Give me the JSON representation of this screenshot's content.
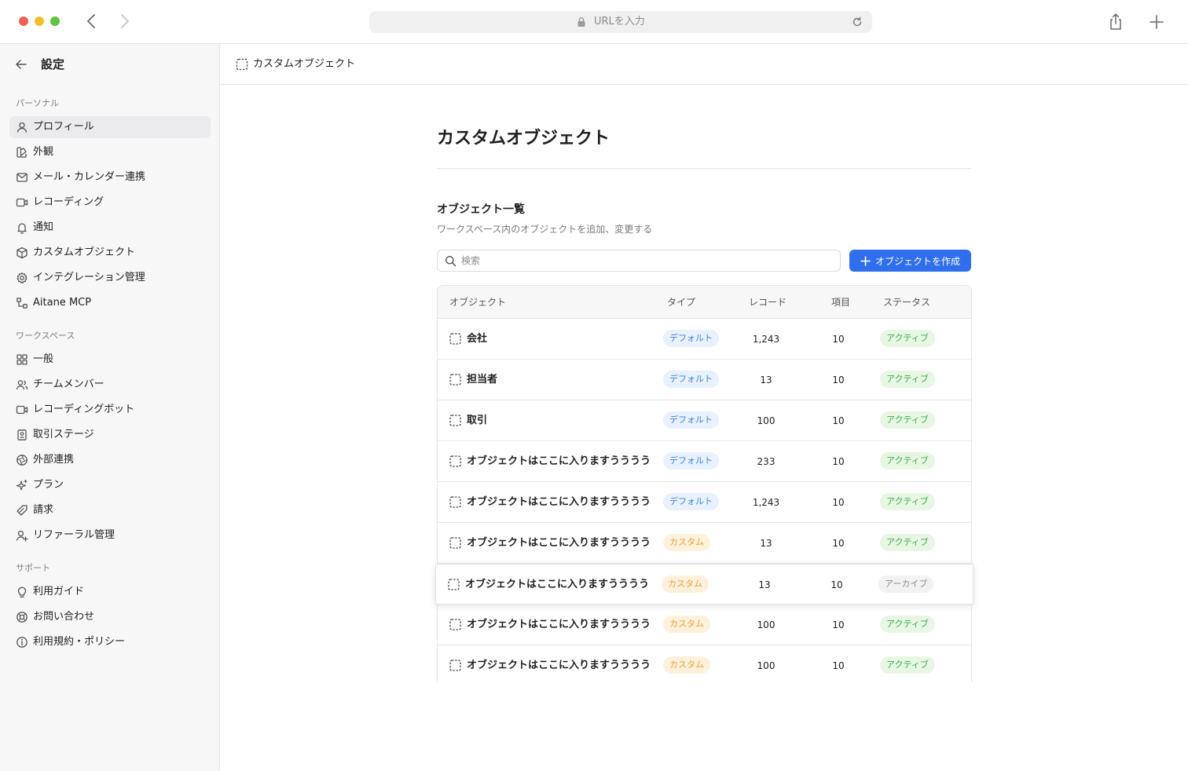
{
  "browser": {
    "url_placeholder": "URLを入力"
  },
  "sidebar": {
    "title": "設定",
    "sections": [
      {
        "label": "パーソナル",
        "items": [
          {
            "label": "プロフィール",
            "icon": "user-icon",
            "active": true
          },
          {
            "label": "外観",
            "icon": "palette-icon"
          },
          {
            "label": "メール・カレンダー連携",
            "icon": "mail-icon"
          },
          {
            "label": "レコーディング",
            "icon": "video-icon"
          },
          {
            "label": "通知",
            "icon": "bell-icon"
          },
          {
            "label": "カスタムオブジェクト",
            "icon": "cube-icon"
          },
          {
            "label": "インテグレーション管理",
            "icon": "gear-icon"
          },
          {
            "label": "Aitane MCP",
            "icon": "connection-icon"
          }
        ]
      },
      {
        "label": "ワークスペース",
        "items": [
          {
            "label": "一般",
            "icon": "grid-icon"
          },
          {
            "label": "チームメンバー",
            "icon": "users-icon"
          },
          {
            "label": "レコーディングボット",
            "icon": "video-icon"
          },
          {
            "label": "取引ステージ",
            "icon": "receipt-icon"
          },
          {
            "label": "外部連携",
            "icon": "aperture-icon"
          },
          {
            "label": "プラン",
            "icon": "sparkle-icon"
          },
          {
            "label": "請求",
            "icon": "tag-icon"
          },
          {
            "label": "リファーラル管理",
            "icon": "user-plus-icon"
          }
        ]
      },
      {
        "label": "サポート",
        "items": [
          {
            "label": "利用ガイド",
            "icon": "lightbulb-icon"
          },
          {
            "label": "お問い合わせ",
            "icon": "lifebuoy-icon"
          },
          {
            "label": "利用規約・ポリシー",
            "icon": "info-icon"
          }
        ]
      }
    ]
  },
  "topbar": {
    "title": "カスタムオブジェクト"
  },
  "main": {
    "page_title": "カスタムオブジェクト",
    "section_title": "オブジェクト一覧",
    "section_desc": "ワークスペース内のオブジェクトを追加、変更する",
    "search_placeholder": "検索",
    "create_button": "オブジェクトを作成"
  },
  "table": {
    "headers": [
      "オブジェクト",
      "タイプ",
      "レコード",
      "項目",
      "ステータス"
    ],
    "rows": [
      {
        "name": "会社",
        "type": "デフォルト",
        "type_kind": "default",
        "records": "1,243",
        "fields": "10",
        "status": "アクティブ",
        "status_kind": "active"
      },
      {
        "name": "担当者",
        "type": "デフォルト",
        "type_kind": "default",
        "records": "13",
        "fields": "10",
        "status": "アクティブ",
        "status_kind": "active"
      },
      {
        "name": "取引",
        "type": "デフォルト",
        "type_kind": "default",
        "records": "100",
        "fields": "10",
        "status": "アクティブ",
        "status_kind": "active"
      },
      {
        "name": "オブジェクトはここに入りますうううう",
        "type": "デフォルト",
        "type_kind": "default",
        "records": "233",
        "fields": "10",
        "status": "アクティブ",
        "status_kind": "active"
      },
      {
        "name": "オブジェクトはここに入りますうううう",
        "type": "デフォルト",
        "type_kind": "default",
        "records": "1,243",
        "fields": "10",
        "status": "アクティブ",
        "status_kind": "active"
      },
      {
        "name": "オブジェクトはここに入りますうううう",
        "type": "カスタム",
        "type_kind": "custom",
        "records": "13",
        "fields": "10",
        "status": "アクティブ",
        "status_kind": "active"
      },
      {
        "name": "オブジェクトはここに入りますうううう",
        "type": "カスタム",
        "type_kind": "custom",
        "records": "13",
        "fields": "10",
        "status": "アーカイブ",
        "status_kind": "archived",
        "hovered": true
      },
      {
        "name": "オブジェクトはここに入りますうううう",
        "type": "カスタム",
        "type_kind": "custom",
        "records": "100",
        "fields": "10",
        "status": "アクティブ",
        "status_kind": "active"
      },
      {
        "name": "オブジェクトはここに入りますうううう",
        "type": "カスタム",
        "type_kind": "custom",
        "records": "100",
        "fields": "10",
        "status": "アクティブ",
        "status_kind": "active"
      }
    ]
  },
  "colors": {
    "accent": "#2f6fed",
    "default_badge_bg": "#e8f1fd",
    "custom_badge_bg": "#fff1dc",
    "active_badge_bg": "#e7f7e4",
    "archived_badge_bg": "#f2f2f2"
  }
}
